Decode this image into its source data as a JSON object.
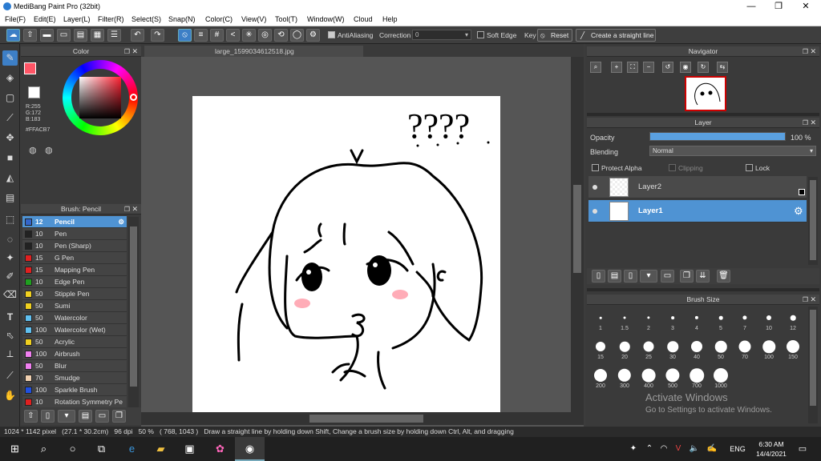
{
  "window": {
    "title": "MediBang Paint Pro (32bit)",
    "minimize": "—",
    "maximize": "❐",
    "close": "✕"
  },
  "menu": [
    "File(F)",
    "Edit(E)",
    "Layer(L)",
    "Filter(R)",
    "Select(S)",
    "Snap(N)",
    "Color(C)",
    "View(V)",
    "Tool(T)",
    "Window(W)",
    "Cloud",
    "Help"
  ],
  "toolbar": {
    "antialiasing": "AntiAliasing",
    "correction_label": "Correction",
    "correction_value": "0",
    "soft_edge": "Soft Edge",
    "key": "Key",
    "reset": "Reset",
    "straight_line": "Create a straight line"
  },
  "color_panel": {
    "title": "Color",
    "rgb": "R:255\nG:172\nB:183",
    "hex": "#FFACB7",
    "fg": "#FFACB7"
  },
  "brush_panel": {
    "title": "Brush: Pencil",
    "items": [
      {
        "size": "12",
        "name": "Pencil",
        "color": "#3366cc",
        "selected": true
      },
      {
        "size": "10",
        "name": "Pen",
        "color": "#222222"
      },
      {
        "size": "10",
        "name": "Pen (Sharp)",
        "color": "#222222"
      },
      {
        "size": "15",
        "name": "G Pen",
        "color": "#e02020"
      },
      {
        "size": "15",
        "name": "Mapping Pen",
        "color": "#e02020"
      },
      {
        "size": "10",
        "name": "Edge Pen",
        "color": "#20a020"
      },
      {
        "size": "50",
        "name": "Stipple Pen",
        "color": "#f0d020"
      },
      {
        "size": "50",
        "name": "Sumi",
        "color": "#f0d020"
      },
      {
        "size": "50",
        "name": "Watercolor",
        "color": "#60c0f0"
      },
      {
        "size": "100",
        "name": "Watercolor (Wet)",
        "color": "#60c0f0"
      },
      {
        "size": "50",
        "name": "Acrylic",
        "color": "#f0d020"
      },
      {
        "size": "100",
        "name": "Airbrush",
        "color": "#f080f0"
      },
      {
        "size": "50",
        "name": "Blur",
        "color": "#f080f0"
      },
      {
        "size": "70",
        "name": "Smudge",
        "color": "#f0d0b0"
      },
      {
        "size": "100",
        "name": "Sparkle Brush",
        "color": "#2050e0"
      },
      {
        "size": "10",
        "name": "Rotation Symmetry Pe",
        "color": "#e02020"
      }
    ]
  },
  "canvas": {
    "tab": "large_1599034612518.jpg",
    "scribble": "????"
  },
  "navigator": {
    "title": "Navigator"
  },
  "layer_panel": {
    "title": "Layer",
    "opacity_label": "Opacity",
    "opacity_value": "100 %",
    "opacity": 1.0,
    "blending_label": "Blending",
    "blending_value": "Normal",
    "protect_alpha": "Protect Alpha",
    "clipping": "Clipping",
    "lock": "Lock",
    "layers": [
      {
        "name": "Layer2",
        "selected": false
      },
      {
        "name": "Layer1",
        "selected": true
      }
    ]
  },
  "brush_size": {
    "title": "Brush Size",
    "sizes": [
      "1",
      "1.5",
      "2",
      "3",
      "4",
      "5",
      "7",
      "10",
      "12",
      "15",
      "20",
      "25",
      "30",
      "40",
      "50",
      "70",
      "100",
      "150",
      "200",
      "300",
      "400",
      "500",
      "700",
      "1000"
    ]
  },
  "status": {
    "text": "1024 * 1142 pixel   (27.1 * 30.2cm)   96 dpi   50 %   ( 768, 1043 )   Draw a straight line by holding down Shift, Change a brush size by holding down Ctrl, Alt, and dragging"
  },
  "watermark": {
    "line1": "Activate Windows",
    "line2": "Go to Settings to activate Windows."
  },
  "taskbar": {
    "lang": "ENG",
    "time": "6:30 AM",
    "date": "14/4/2021",
    "notif": "2"
  }
}
